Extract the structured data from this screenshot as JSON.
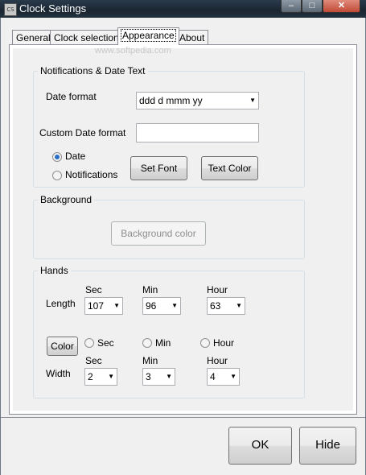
{
  "window": {
    "title": "Clock Settings",
    "icon": "clock-app-icon"
  },
  "controls": {
    "minimize": "–",
    "maximize": "□",
    "close": "✕"
  },
  "tabs": [
    {
      "label": "General"
    },
    {
      "label": "Clock selection"
    },
    {
      "label": "Appearance"
    },
    {
      "label": "About"
    }
  ],
  "active_tab": "Appearance",
  "watermark": "www.softpedia.com",
  "notifications": {
    "legend": "Notifications & Date Text",
    "date_format_label": "Date format",
    "date_format_value": "ddd d mmm yy",
    "custom_format_label": "Custom Date format",
    "custom_format_value": "",
    "radio_date": "Date",
    "radio_notifications": "Notifications",
    "set_font": "Set Font",
    "text_color": "Text Color"
  },
  "background": {
    "legend": "Background",
    "color_button": "Background color"
  },
  "hands": {
    "legend": "Hands",
    "sec_label": "Sec",
    "min_label": "Min",
    "hour_label": "Hour",
    "length_label": "Length",
    "length_sec": "107",
    "length_min": "96",
    "length_hour": "63",
    "color_button": "Color",
    "radio_sec": "Sec",
    "radio_min": "Min",
    "radio_hour": "Hour",
    "width_label": "Width",
    "width_sec": "2",
    "width_min": "3",
    "width_hour": "4"
  },
  "footer": {
    "ok": "OK",
    "hide": "Hide"
  }
}
